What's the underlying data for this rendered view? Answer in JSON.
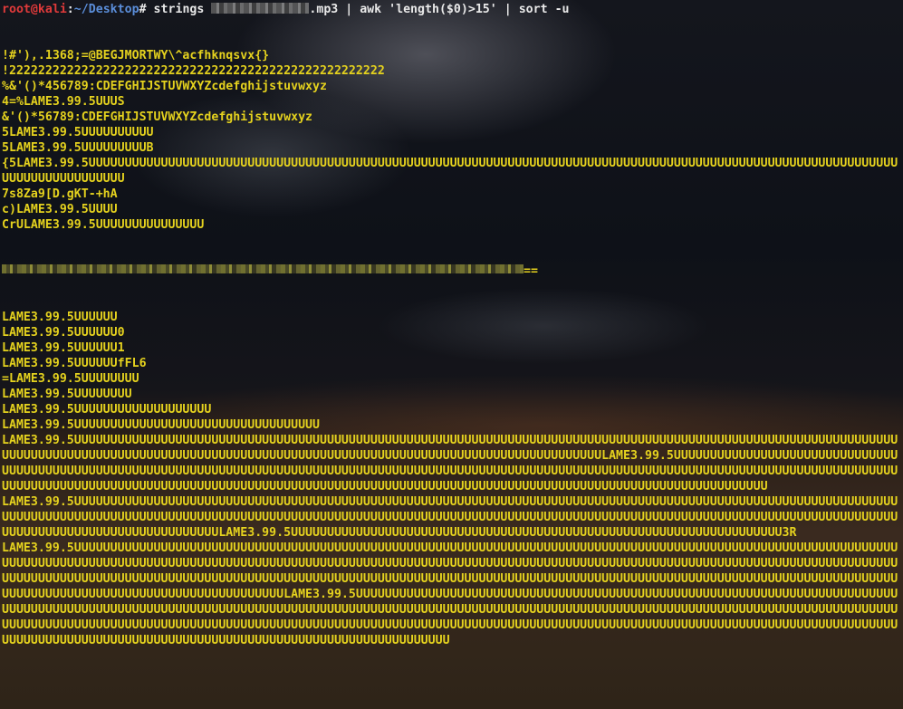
{
  "prompt": {
    "user_host": "root@kali",
    "colon": ":",
    "path": "~/Desktop",
    "symbol": "#",
    "cmd_before": " strings ",
    "cmd_after": ".mp3 | awk 'length($0)>15' | sort -u"
  },
  "output_before_redacted": [
    "!#'),.1368;=@BEGJMORTWY\\^acfhknqsvx{}",
    "!2222222222222222222222222222222222222222222222222222",
    "%&'()*456789:CDEFGHIJSTUVWXYZcdefghijstuvwxyz",
    "4=%LAME3.99.5UUUS",
    "&'()*56789:CDEFGHIJSTUVWXYZcdefghijstuvwxyz",
    "5LAME3.99.5UUUUUUUUUU",
    "5LAME3.99.5UUUUUUUUUB",
    "{5LAME3.99.5UUUUUUUUUUUUUUUUUUUUUUUUUUUUUUUUUUUUUUUUUUUUUUUUUUUUUUUUUUUUUUUUUUUUUUUUUUUUUUUUUUUUUUUUUUUUUUUUUUUUUUUUUUUUUUUUUUUUUUUUUUUUUUUUU",
    "7s8Za9[D.gKT-+hA",
    "c)LAME3.99.5UUUU",
    "CrULAME3.99.5UUUUUUUUUUUUUUU"
  ],
  "redacted_suffix": "==",
  "output_after_redacted": [
    "LAME3.99.5UUUUUU",
    "LAME3.99.5UUUUUU0",
    "LAME3.99.5UUUUUU1",
    "LAME3.99.5UUUUUUfFL6",
    "=LAME3.99.5UUUUUUUU",
    "LAME3.99.5UUUUUUUU",
    "LAME3.99.5UUUUUUUUUUUUUUUUUUU",
    "LAME3.99.5UUUUUUUUUUUUUUUUUUUUUUUUUUUUUUUUUU",
    "LAME3.99.5UUUUUUUUUUUUUUUUUUUUUUUUUUUUUUUUUUUUUUUUUUUUUUUUUUUUUUUUUUUUUUUUUUUUUUUUUUUUUUUUUUUUUUUUUUUUUUUUUUUUUUUUUUUUUUUUUUUUUUUUUUUUUUUUUUUUUUUUUUUUUUUUUUUUUUUUUUUUUUUUUUUUUUUUUUUUUUUUUUUUUUUUUUUUUUUUUUUUULAME3.99.5UUUUUUUUUUUUUUUUUUUUUUUUUUUUUUUUUUUUUUUUUUUUUUUUUUUUUUUUUUUUUUUUUUUUUUUUUUUUUUUUUUUUUUUUUUUUUUUUUUUUUUUUUUUUUUUUUUUUUUUUUUUUUUUUUUUUUUUUUUUUUUUUUUUUUUUUUUUUUUUUUUUUUUUUUUUUUUUUUUUUUUUUUUUUUUUUUUUUUUUUUUUUUUUUUUUUUUUUUUUUUUUUUUUUUUUUUUUUUUUUUUUUUUUUUUUUUUUUUUUUU",
    "LAME3.99.5UUUUUUUUUUUUUUUUUUUUUUUUUUUUUUUUUUUUUUUUUUUUUUUUUUUUUUUUUUUUUUUUUUUUUUUUUUUUUUUUUUUUUUUUUUUUUUUUUUUUUUUUUUUUUUUUUUUUUUUUUUUUUUUUUUUUUUUUUUUUUUUUUUUUUUUUUUUUUUUUUUUUUUUUUUUUUUUUUUUUUUUUUUUUUUUUUUUUUUUUUUUUUUUUUUUUUUUUUUUUUUUUUUUUUUUUUUUUUUUUUUUUUUUUUUUUUUUUUUUUUUUUUUUULAME3.99.5UUUUUUUUUUUUUUUUUUUUUUUUUUUUUUUUUUUUUUUUUUUUUUUUUUUUUUUUUUUUUUUUUUUU3R",
    "LAME3.99.5UUUUUUUUUUUUUUUUUUUUUUUUUUUUUUUUUUUUUUUUUUUUUUUUUUUUUUUUUUUUUUUUUUUUUUUUUUUUUUUUUUUUUUUUUUUUUUUUUUUUUUUUUUUUUUUUUUUUUUUUUUUUUUUUUUUUUUUUUUUUUUUUUUUUUUUUUUUUUUUUUUUUUUUUUUUUUUUUUUUUUUUUUUUUUUUUUUUUUUUUUUUUUUUUUUUUUUUUUUUUUUUUUUUUUUUUUUUUUUUUUUUUUUUUUUUUUUUUUUUUUUUUUUUUUUUUUUUUUUUUUUUUUUUUUUUUUUUUUUUUUUUUUUUUUUUUUUUUUUUUUUUUUUUUUUUUUUUUUUUUUUUUUUUUUUUUUUUUUUUUUUUUUUUUUUUUUUUUUUUUUUUUUUUUUUUUUUUUUUUUULAME3.99.5UUUUUUUUUUUUUUUUUUUUUUUUUUUUUUUUUUUUUUUUUUUUUUUUUUUUUUUUUUUUUUUUUUUUUUUUUUUUUUUUUUUUUUUUUUUUUUUUUUUUUUUUUUUUUUUUUUUUUUUUUUUUUUUUUUUUUUUUUUUUUUUUUUUUUUUUUUUUUUUUUUUUUUUUUUUUUUUUUUUUUUUUUUUUUUUUUUUUUUUUUUUUUUUUUUUUUUUUUUUUUUUUUUUUUUUUUUUUUUUUUUUUUUUUUUUUUUUUUUUUUUUUUUUUUUUUUUUUUUUUUUUUUUUUUUUUUUUUUUUUUUUUUUUUUUUUUUUUUUUUUUUUUUUUUUUUUUUUUUUUUUUUUUUUUUUUUUUUUUUUUUUUUUUUUUUUUUUUUUUUUUUUU"
  ]
}
